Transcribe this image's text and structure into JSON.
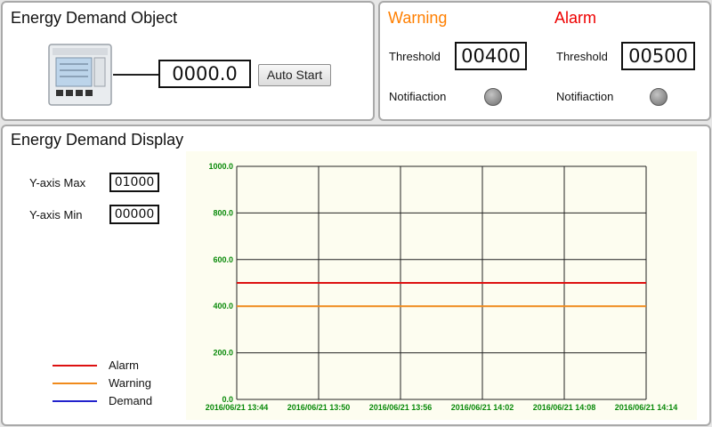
{
  "object_panel": {
    "title": "Energy Demand Object",
    "value": "0000.0",
    "auto_start_label": "Auto Start"
  },
  "threshold_panel": {
    "warning": {
      "title": "Warning",
      "color": "#ff7f00",
      "threshold_label": "Threshold",
      "threshold_value": "00400",
      "notification_label": "Notifiaction"
    },
    "alarm": {
      "title": "Alarm",
      "color": "#ee0000",
      "threshold_label": "Threshold",
      "threshold_value": "00500",
      "notification_label": "Notifiaction"
    }
  },
  "display_panel": {
    "title": "Energy Demand Display",
    "ymax_label": "Y-axis Max",
    "ymax_value": "01000",
    "ymin_label": "Y-axis Min",
    "ymin_value": "00000",
    "legend": [
      {
        "label": "Alarm",
        "color": "#dd1111"
      },
      {
        "label": "Warning",
        "color": "#f08a1c"
      },
      {
        "label": "Demand",
        "color": "#2222cc"
      }
    ]
  },
  "chart_data": {
    "type": "line",
    "ylim": [
      0,
      1000
    ],
    "y_ticks": [
      "1000.0",
      "800.0",
      "600.0",
      "400.0",
      "200.0",
      "0.0"
    ],
    "y_tick_values": [
      1000,
      800,
      600,
      400,
      200,
      0
    ],
    "x_ticks": [
      "2016/06/21 13:44",
      "2016/06/21 13:50",
      "2016/06/21 13:56",
      "2016/06/21 14:02",
      "2016/06/21 14:08",
      "2016/06/21 14:14"
    ],
    "series": [
      {
        "name": "Alarm",
        "color": "#dd1111",
        "values": [
          500,
          500,
          500,
          500,
          500,
          500
        ]
      },
      {
        "name": "Warning",
        "color": "#f08a1c",
        "values": [
          400,
          400,
          400,
          400,
          400,
          400
        ]
      },
      {
        "name": "Demand",
        "color": "#2222cc",
        "values": []
      }
    ],
    "tick_color": "#0a8a0a",
    "grid": true
  }
}
